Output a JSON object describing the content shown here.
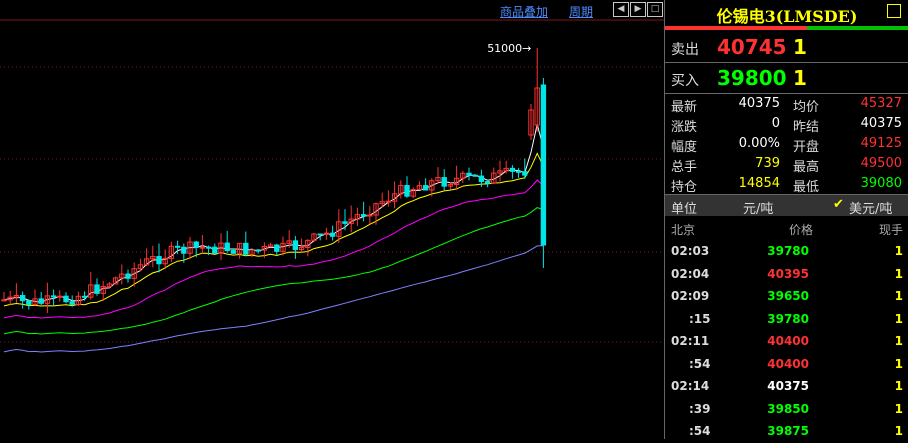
{
  "toolbar": {
    "overlay_label": "商品叠加",
    "period_label": "周期"
  },
  "chart": {
    "max_label": "51000",
    "colors": {
      "up": "#ff3232",
      "down": "#00e5e5",
      "ma5": "#ffffff",
      "ma10": "#ffff00",
      "ma20": "#ff00ff",
      "ma40": "#00ff00",
      "ma60": "#8080ff",
      "grid": "#7a1a1a"
    }
  },
  "panel": {
    "title": "伦锡电3(LMSDE)",
    "sell": {
      "label": "卖出",
      "price": "40745",
      "qty": "1"
    },
    "buy": {
      "label": "买入",
      "price": "39800",
      "qty": "1"
    },
    "stats_left": [
      {
        "label": "最新",
        "value": "40375",
        "color": "#ffffff"
      },
      {
        "label": "涨跌",
        "value": "0",
        "color": "#ffffff"
      },
      {
        "label": "幅度",
        "value": "0.00%",
        "color": "#ffffff"
      },
      {
        "label": "总手",
        "value": "739",
        "color": "#ffff00"
      },
      {
        "label": "持仓",
        "value": "14854",
        "color": "#ffff00"
      }
    ],
    "stats_right": [
      {
        "label": "均价",
        "value": "45327",
        "color": "#ff3232"
      },
      {
        "label": "昨结",
        "value": "40375",
        "color": "#ffffff"
      },
      {
        "label": "开盘",
        "value": "49125",
        "color": "#ff3232"
      },
      {
        "label": "最高",
        "value": "49500",
        "color": "#ff3232"
      },
      {
        "label": "最低",
        "value": "39080",
        "color": "#00ff00"
      }
    ],
    "unit": {
      "label": "单位",
      "option1": "元/吨",
      "option2": "美元/吨"
    },
    "ticks_header": {
      "time": "北京",
      "price": "价格",
      "vol": "现手"
    },
    "ticks": [
      {
        "time": "02:03",
        "price": "39780",
        "vol": "1",
        "color": "#00ff00"
      },
      {
        "time": "02:04",
        "price": "40395",
        "vol": "1",
        "color": "#ff3232"
      },
      {
        "time": "02:09",
        "price": "39650",
        "vol": "1",
        "color": "#00ff00"
      },
      {
        "time": ":15",
        "price": "39780",
        "vol": "1",
        "color": "#00ff00"
      },
      {
        "time": "02:11",
        "price": "40400",
        "vol": "1",
        "color": "#ff3232"
      },
      {
        "time": ":54",
        "price": "40400",
        "vol": "1",
        "color": "#ff3232"
      },
      {
        "time": "02:14",
        "price": "40375",
        "vol": "1",
        "color": "#ffffff"
      },
      {
        "time": ":39",
        "price": "39850",
        "vol": "1",
        "color": "#00ff00"
      },
      {
        "time": ":54",
        "price": "39875",
        "vol": "1",
        "color": "#00ff00"
      }
    ]
  }
}
